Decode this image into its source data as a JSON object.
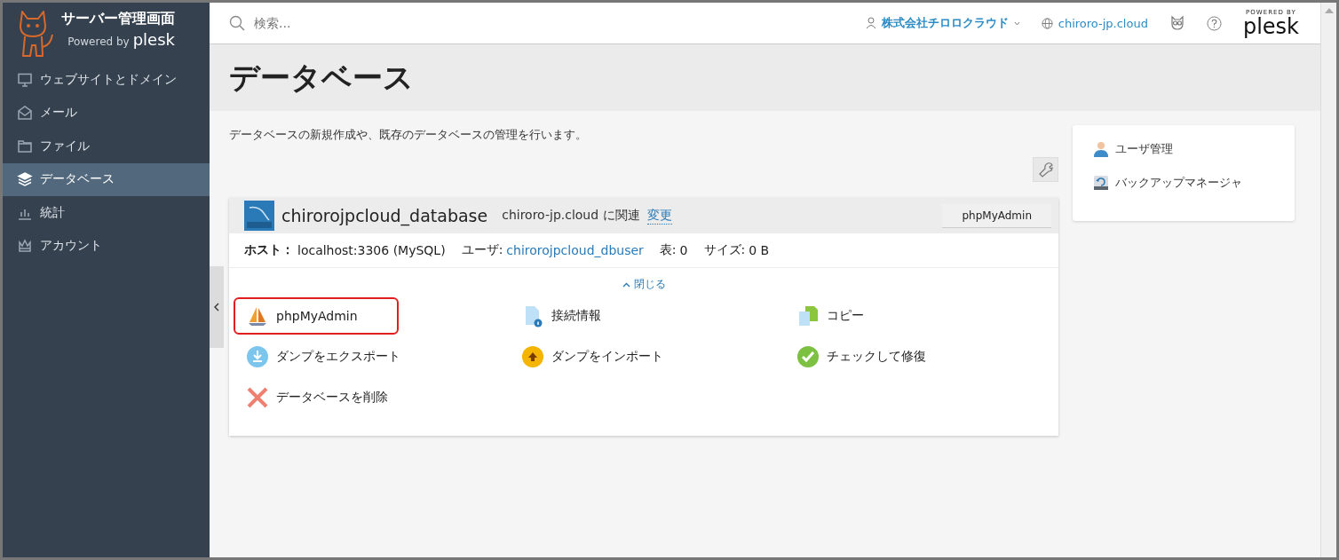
{
  "brand": {
    "title": "サーバー管理画面",
    "powered": "Powered by",
    "product": "plesk"
  },
  "sidebar": {
    "items": [
      {
        "label": "ウェブサイトとドメイン",
        "kind": "monitor",
        "selected": false
      },
      {
        "label": "メール",
        "kind": "mail",
        "selected": false
      },
      {
        "label": "ファイル",
        "kind": "folder",
        "selected": false
      },
      {
        "label": "データベース",
        "kind": "layers",
        "selected": true
      },
      {
        "label": "統計",
        "kind": "chart",
        "selected": false
      },
      {
        "label": "アカウント",
        "kind": "crown",
        "selected": false
      }
    ]
  },
  "header": {
    "search": {
      "placeholder": "検索..."
    },
    "account": "株式会社チロロクラウド",
    "domain": "chiroro-jp.cloud",
    "badge_top": "POWERED BY",
    "badge_product": "plesk"
  },
  "page": {
    "title": "データベース",
    "description": "データベースの新規作成や、既存のデータベースの管理を行います。"
  },
  "database": {
    "name": "chirorojpcloud_database",
    "related_domain": "chiroro-jp.cloud",
    "related_suffix": "に関連",
    "change_link": "変更",
    "button": "phpMyAdmin",
    "host_label": "ホスト：",
    "host": "localhost:3306 (MySQL)",
    "user_label": "ユーザ:",
    "user": "chirorojpcloud_dbuser",
    "tables_label": "表:",
    "tables": "0",
    "size_label": "サイズ:",
    "size": "0 B",
    "collapse": "閉じる",
    "actions": [
      {
        "label": "phpMyAdmin",
        "kind": "sailboat",
        "highlighted": true
      },
      {
        "label": "接続情報",
        "kind": "info",
        "highlighted": false
      },
      {
        "label": "コピー",
        "kind": "copy",
        "highlighted": false
      },
      {
        "label": "ダンプをエクスポート",
        "kind": "export",
        "highlighted": false
      },
      {
        "label": "ダンプをインポート",
        "kind": "import",
        "highlighted": false
      },
      {
        "label": "チェックして修復",
        "kind": "check",
        "highlighted": false
      },
      {
        "label": "データベースを削除",
        "kind": "delete",
        "highlighted": false
      }
    ]
  },
  "side_panel": {
    "links": [
      {
        "label": "ユーザ管理",
        "kind": "user"
      },
      {
        "label": "バックアップマネージャ",
        "kind": "backup"
      }
    ]
  }
}
